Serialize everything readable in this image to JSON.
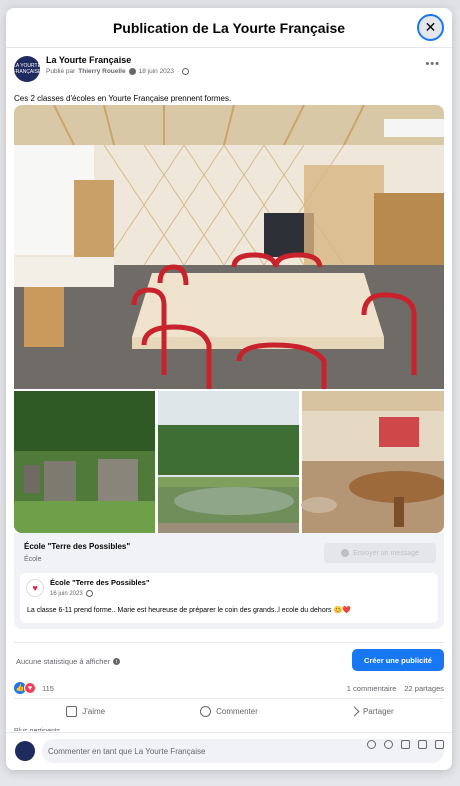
{
  "modal": {
    "title": "Publication de La Yourte Française",
    "close_icon": "✕"
  },
  "post": {
    "page_name": "La Yourte Française",
    "avatar_text": "LA YOURTE FRANÇAISE",
    "published_by_prefix": "Publié par",
    "published_by": "Thierry Rouelle",
    "date": "18 juin 2023",
    "text": "Ces 2 classes d'écoles en Yourte Française prennent formes.",
    "more_icon": "•••"
  },
  "link_card": {
    "title": "École \"Terre des Possibles\"",
    "subtitle": "École",
    "message_button": "Envoyer un message",
    "embed": {
      "name": "École \"Terre des Possibles\"",
      "date": "16 juin 2023",
      "text": "La classe 6-11 prend forme.. Marie est heureuse de préparer le coin des grands..l ecole  du dehors 😊❤️"
    }
  },
  "stats": {
    "no_stats": "Aucune statistique à afficher",
    "info_icon": "i",
    "ad_button": "Créer une publicité"
  },
  "reactions": {
    "count": "115",
    "comments": "1 commentaire",
    "shares": "22 partages",
    "like_icon": "👍",
    "love_icon": "♥"
  },
  "actions": {
    "like": "J'aime",
    "comment": "Commenter",
    "share": "Partager"
  },
  "more_relevant": "Plus pertinents",
  "comment_bar": {
    "placeholder": "Commenter en tant que La Yourte Française"
  },
  "colors": {
    "accent": "#1877f2",
    "love": "#f33e58",
    "text_secondary": "#65676b"
  }
}
